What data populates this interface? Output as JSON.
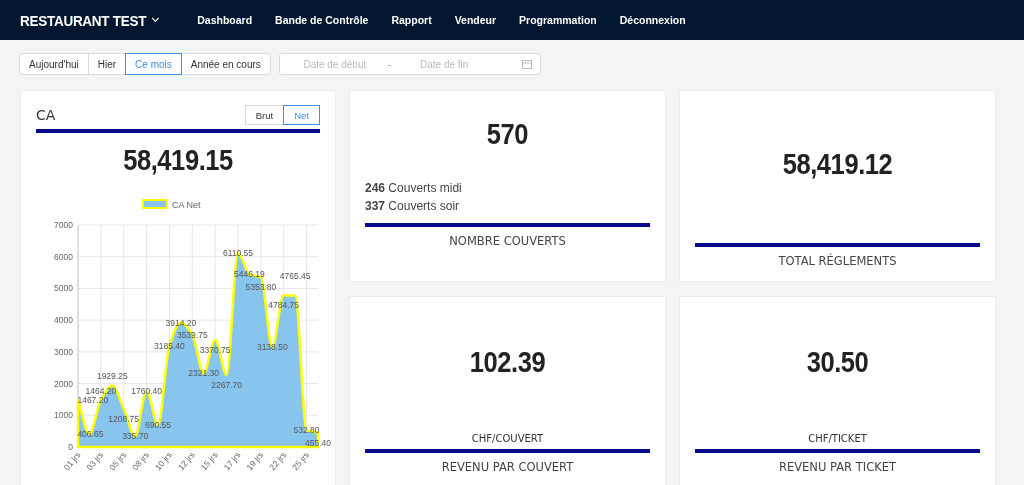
{
  "nav": {
    "brand": "RESTAURANT TEST",
    "links": [
      "Dashboard",
      "Bande de Contrôle",
      "Rapport",
      "Vendeur",
      "Programmation",
      "Déconnexion"
    ]
  },
  "filters": {
    "periods": [
      {
        "label": "Aujourd'hui",
        "selected": false
      },
      {
        "label": "Hier",
        "selected": false
      },
      {
        "label": "Ce mois",
        "selected": true
      },
      {
        "label": "Année en cours",
        "selected": false
      }
    ],
    "date_range": {
      "start_placeholder": "Date de début",
      "separator": "-",
      "end_placeholder": "Date de fin"
    }
  },
  "ca_card": {
    "title": "CA",
    "modes": [
      {
        "label": "Brut",
        "selected": false
      },
      {
        "label": "Net",
        "selected": true
      }
    ],
    "total": "58,419.15",
    "chart_data": {
      "type": "area",
      "ylim": [
        0,
        7000
      ],
      "yticks": [
        0,
        1000,
        2000,
        3000,
        4000,
        5000,
        6000,
        7000
      ],
      "categories": [
        "01 jrs",
        null,
        "03 jrs",
        null,
        "05 jrs",
        null,
        "08 jrs",
        null,
        "10 jrs",
        null,
        "12 jrs",
        null,
        "15 jrs",
        null,
        "17 jrs",
        null,
        "19 jrs",
        null,
        "22 jrs",
        null,
        "25 jrs",
        null
      ],
      "grid": true,
      "value_labels": [
        "1467.20",
        "406.65",
        "1464.20",
        "1929.25",
        "1208.75",
        "335.70",
        "1760.40",
        "690.55",
        "3185.40",
        "3914.20",
        "3539.75",
        "2321.30",
        "3370.75",
        "2267.70",
        "6110.55",
        "5446.19",
        "5353.80",
        "3138.50",
        "4784.75",
        "4765.45",
        "532.80",
        "455.40"
      ],
      "series": [
        {
          "name": "CA Net",
          "color": "#87c5ee",
          "values": [
            1467.2,
            406.65,
            1464.2,
            1929.25,
            1208.75,
            335.7,
            1760.4,
            690.55,
            3185.4,
            3914.2,
            3539.75,
            2321.3,
            3370.75,
            2267.7,
            6110.55,
            5446.19,
            5353.8,
            3138.5,
            4784.75,
            4765.45,
            532.8,
            455.4
          ]
        }
      ]
    }
  },
  "stats": [
    {
      "kind": "covers",
      "value": "570",
      "details": [
        "**246** Couverts midi",
        "**337** Couverts soir"
      ],
      "title": "NOMBRE COUVERTS"
    },
    {
      "kind": "plain",
      "value": "58,419.12",
      "title": "TOTAL RÉGLEMENTS"
    },
    {
      "kind": "unit",
      "value": "102.39",
      "unit": "CHF/COUVERT",
      "title": "REVENU PAR COUVERT"
    },
    {
      "kind": "unit",
      "value": "30.50",
      "unit": "CHF/TICKET",
      "title": "REVENU PAR TICKET"
    }
  ]
}
